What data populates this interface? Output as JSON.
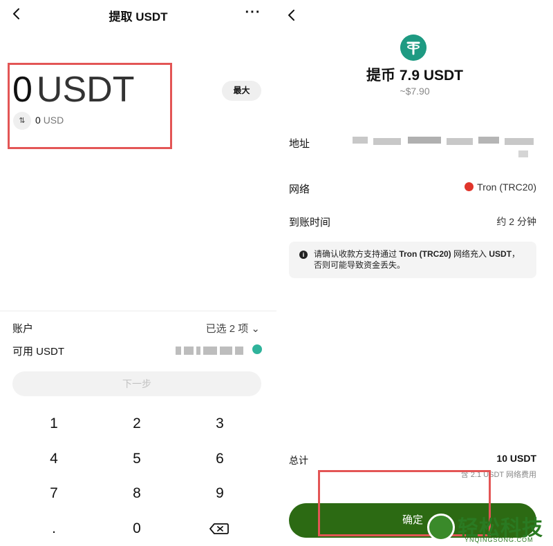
{
  "left": {
    "header": {
      "title": "提取 USDT",
      "more_label": "···"
    },
    "amount": {
      "value": "0",
      "unit": "USDT"
    },
    "converted": {
      "value": "0",
      "unit": "USD",
      "toggle_glyph": "⇅"
    },
    "max_label": "最大",
    "account": {
      "label": "账户",
      "value": "已选 2 项 ⌄"
    },
    "available": {
      "label": "可用 USDT"
    },
    "next_label": "下一步",
    "keypad": [
      "1",
      "2",
      "3",
      "4",
      "5",
      "6",
      "7",
      "8",
      "9",
      ".",
      "0"
    ]
  },
  "right": {
    "token_glyph": "₮",
    "title": "提币 7.9 USDT",
    "subtitle": "~$7.90",
    "address": {
      "label": "地址"
    },
    "network": {
      "label": "网络",
      "value": "Tron (TRC20)"
    },
    "arrival": {
      "label": "到账时间",
      "value": "约 2 分钟"
    },
    "notice": {
      "prefix": "请确认收款方支持通过 ",
      "network": "Tron (TRC20)",
      "middle": " 网络充入 ",
      "token": "USDT",
      "suffix": "，否则可能导致资金丢失。"
    },
    "total": {
      "label": "总计",
      "value": "10 USDT",
      "fee_note": "含 2.1 USDT 网络费用"
    },
    "confirm_label": "确定"
  },
  "watermark": {
    "text": "轻松科技",
    "sub": "YNQINGSONG.COM"
  },
  "colors": {
    "highlight_box": "#e35555",
    "confirm_button": "#2c6a13",
    "token_usdt": "#1e9a82",
    "tron_red": "#e0352b"
  }
}
